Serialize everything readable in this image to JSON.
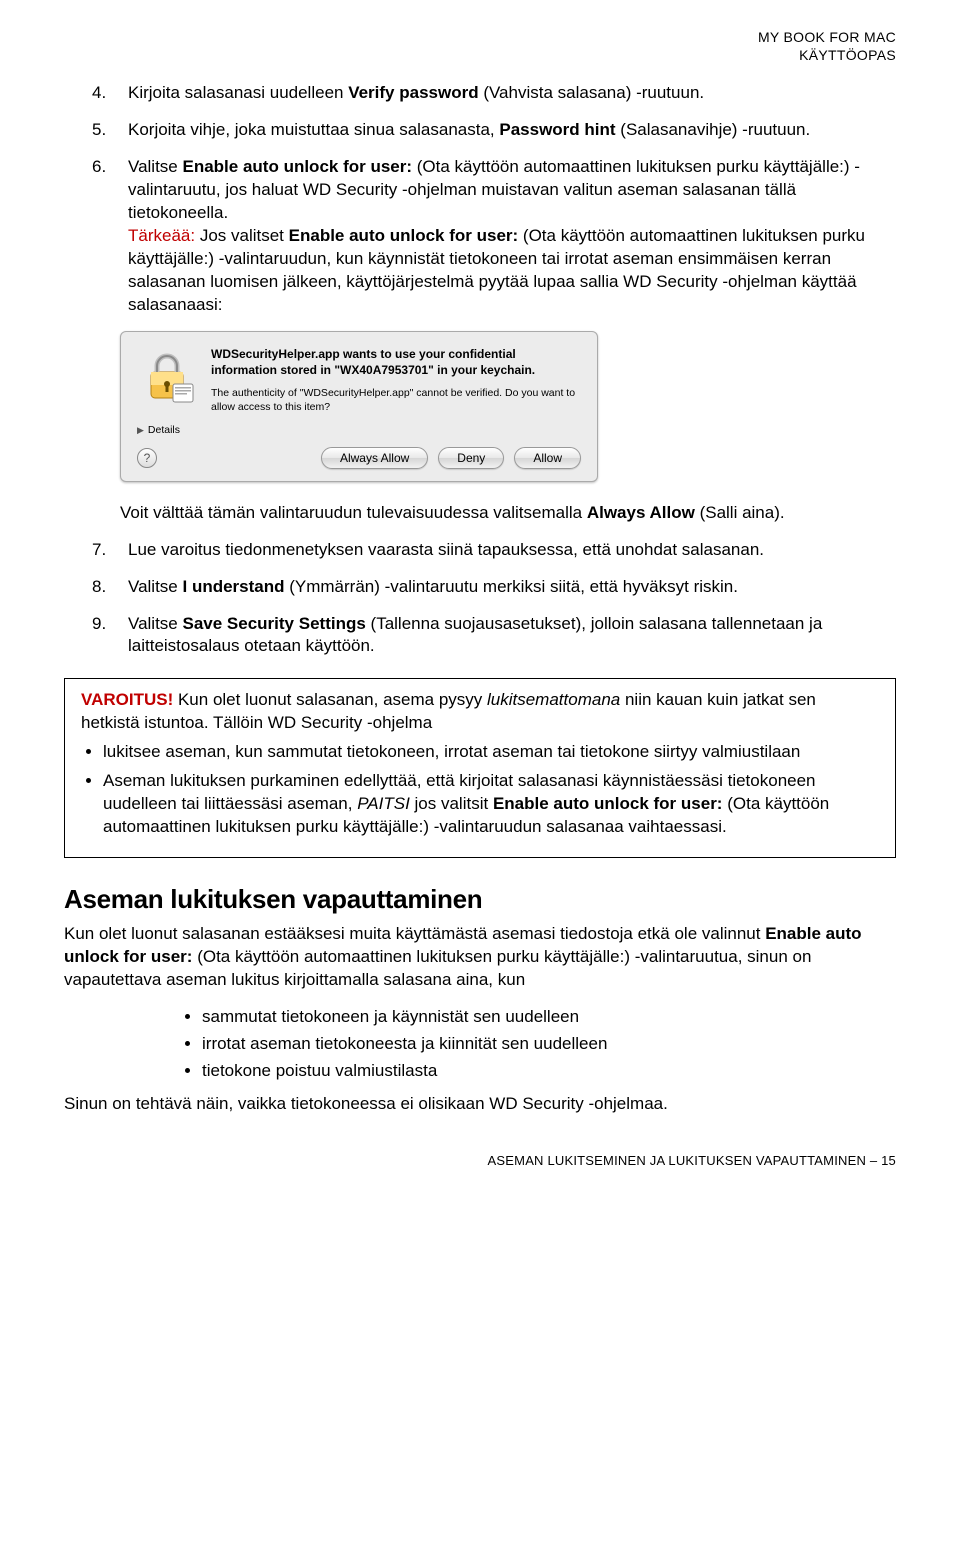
{
  "header": {
    "product": "MY BOOK FOR MAC",
    "doc": "KÄYTTÖOPAS"
  },
  "steps": {
    "s4": {
      "num": "4.",
      "text_a": "Kirjoita salasanasi uudelleen ",
      "b1": "Verify password",
      "text_b": " (Vahvista salasana) -ruutuun."
    },
    "s5": {
      "num": "5.",
      "text_a": "Korjoita vihje, joka muistuttaa sinua salasanasta, ",
      "b1": "Password hint",
      "text_b": " (Salasanavihje) -ruutuun."
    },
    "s6": {
      "num": "6.",
      "text_a": "Valitse ",
      "b1": "Enable auto unlock for user:",
      "text_b": " (Ota käyttöön automaattinen lukituksen purku käyttäjälle:) -valintaruutu, jos haluat WD Security -ohjelman muistavan valitun aseman salasanan tällä tietokoneella.",
      "red_label": "Tärkeää:",
      "imp_a": " Jos valitset ",
      "imp_b1": "Enable auto unlock for user:",
      "imp_b": " (Ota käyttöön automaattinen lukituksen purku käyttäjälle:) -valintaruudun, kun käynnistät tietokoneen tai irrotat aseman ensimmäisen kerran salasanan luomisen jälkeen, käyttöjärjestelmä pyytää lupaa sallia WD Security -ohjelman käyttää salasanaasi:"
    },
    "after_dialog": {
      "text_a": "Voit välttää tämän valintaruudun tulevaisuudessa valitsemalla ",
      "b1": "Always Allow",
      "text_b": " (Salli aina)."
    },
    "s7": {
      "num": "7.",
      "text": "Lue varoitus tiedonmenetyksen vaarasta siinä tapauksessa, että unohdat salasanan."
    },
    "s8": {
      "num": "8.",
      "text_a": "Valitse ",
      "b1": "I understand",
      "text_b": " (Ymmärrän) -valintaruutu merkiksi siitä, että hyväksyt riskin."
    },
    "s9": {
      "num": "9.",
      "text_a": "Valitse ",
      "b1": "Save Security Settings",
      "text_b": " (Tallenna suojausasetukset), jolloin salasana tallennetaan ja laitteistosalaus otetaan käyttöön."
    }
  },
  "dialog": {
    "msg": "WDSecurityHelper.app wants to use your confidential information stored in \"WX40A7953701\" in your keychain.",
    "sub": "The authenticity of \"WDSecurityHelper.app\" cannot be verified. Do you want to allow access to this item?",
    "details": "Details",
    "help": "?",
    "buttons": {
      "always": "Always Allow",
      "deny": "Deny",
      "allow": "Allow"
    }
  },
  "warn": {
    "title": "VAROITUS!",
    "intro_a": " Kun olet luonut salasanan, asema pysyy ",
    "intro_i": "lukitsemattomana",
    "intro_b": " niin kauan kuin jatkat sen hetkistä istuntoa. Tällöin WD Security -ohjelma",
    "b1": "lukitsee aseman, kun sammutat tietokoneen, irrotat aseman tai tietokone siirtyy valmiustilaan",
    "b2_a": "Aseman lukituksen purkaminen edellyttää, että kirjoitat salasanasi käynnistäessäsi tietokoneen uudelleen tai liittäessäsi aseman, ",
    "b2_i": "PAITSI",
    "b2_b": " jos valitsit ",
    "b2_b1": "Enable auto unlock for user:",
    "b2_c": " (Ota käyttöön automaattinen lukituksen purku käyttäjälle:) -valintaruudun salasanaa vaihtaessasi."
  },
  "section2": {
    "heading": "Aseman lukituksen vapauttaminen",
    "p_a": "Kun olet luonut salasanan estääksesi muita käyttämästä asemasi tiedostoja etkä ole valinnut ",
    "p_b1": "Enable auto unlock for user:",
    "p_b": " (Ota käyttöön automaattinen lukituksen purku käyttäjälle:) -valintaruutua, sinun on vapautettava aseman lukitus kirjoittamalla salasana aina, kun",
    "li1": "sammutat tietokoneen ja käynnistät sen uudelleen",
    "li2": "irrotat aseman tietokoneesta ja kiinnität sen uudelleen",
    "li3": "tietokone poistuu valmiustilasta",
    "p_last": "Sinun on tehtävä näin, vaikka tietokoneessa ei olisikaan WD Security -ohjelmaa."
  },
  "footer": {
    "text_a": "ASEMAN LUKITSEMINEN JA LUKITUKSEN VAPAUTTAMINEN – ",
    "page": "15"
  }
}
